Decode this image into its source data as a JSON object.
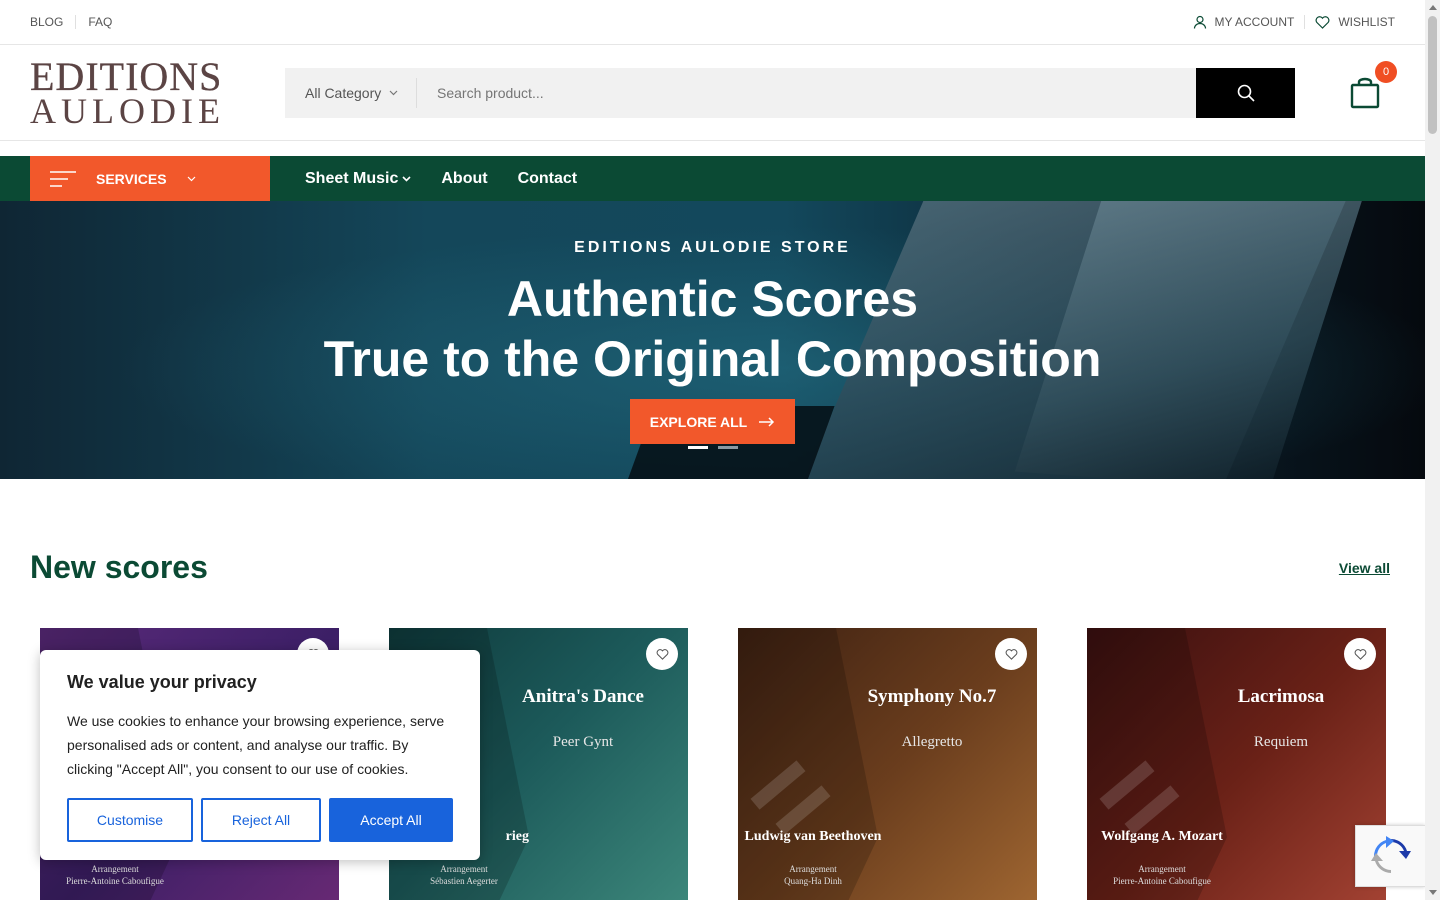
{
  "topbar": {
    "blog": "BLOG",
    "faq": "FAQ",
    "account": "MY ACCOUNT",
    "wishlist": "WISHLIST"
  },
  "header": {
    "logo_line1": "EDITIONS",
    "logo_line2": "AULODIE",
    "category": "All Category",
    "search_placeholder": "Search product...",
    "cart_count": "0"
  },
  "nav": {
    "services": "SERVICES",
    "links": [
      "Sheet Music",
      "About",
      "Contact"
    ]
  },
  "hero": {
    "kicker": "EDITIONS AULODIE STORE",
    "line1": "Authentic Scores",
    "line2": "True to the Original Composition",
    "button": "EXPLORE ALL"
  },
  "section": {
    "title": "New scores",
    "view_all": "View all"
  },
  "products": [
    {
      "title": "",
      "subtitle": "",
      "composer": "",
      "arr_label": "Arrangement",
      "arranger": "Pierre-Antoine Caboufigue"
    },
    {
      "title": "Anitra's Dance",
      "subtitle": "Peer Gynt",
      "composer": "rieg",
      "arr_label": "Arrangement",
      "arranger": "Sébastien Aegerter"
    },
    {
      "title": "Symphony No.7",
      "subtitle": "Allegretto",
      "composer": "Ludwig van Beethoven",
      "arr_label": "Arrangement",
      "arranger": "Quang-Ha Dinh"
    },
    {
      "title": "Lacrimosa",
      "subtitle": "Requiem",
      "composer": "Wolfgang A. Mozart",
      "arr_label": "Arrangement",
      "arranger": "Pierre-Antoine Caboufigue"
    }
  ],
  "cookie": {
    "title": "We value your privacy",
    "body": "We use cookies to enhance your browsing experience, serve personalised ads or content, and analyse our traffic. By clicking \"Accept All\", you consent to our use of cookies.",
    "customise": "Customise",
    "reject": "Reject All",
    "accept": "Accept All"
  },
  "colors": {
    "brand_green": "#0b4a34",
    "accent_orange": "#f2582b",
    "cookie_blue": "#1863dc"
  }
}
